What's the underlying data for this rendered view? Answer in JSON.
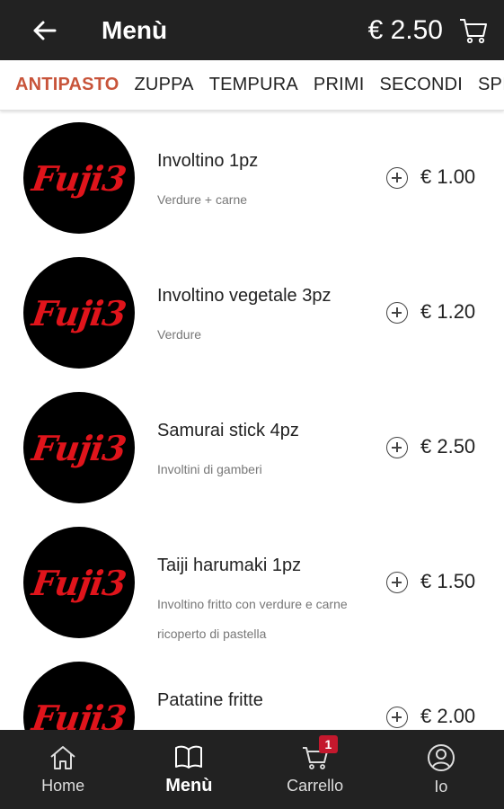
{
  "header": {
    "title": "Menù",
    "total": "€ 2.50",
    "back_icon": "arrow-left-icon",
    "cart_icon": "cart-icon"
  },
  "tabs": [
    {
      "label": "ANTIPASTO",
      "active": true
    },
    {
      "label": "ZUPPA"
    },
    {
      "label": "TEMPURA"
    },
    {
      "label": "PRIMI"
    },
    {
      "label": "SECONDI"
    },
    {
      "label": "SPI"
    }
  ],
  "items": [
    {
      "logo": "Fuji3",
      "name": "Involtino 1pz",
      "desc": "Verdure + carne",
      "price": "€ 1.00"
    },
    {
      "logo": "Fuji3",
      "name": "Involtino vegetale 3pz",
      "desc": "Verdure",
      "price": "€ 1.20"
    },
    {
      "logo": "Fuji3",
      "name": "Samurai stick 4pz",
      "desc": "Involtini di gamberi",
      "price": "€ 2.50"
    },
    {
      "logo": "Fuji3",
      "name": "Taiji harumaki 1pz",
      "desc": "Involtino fritto con verdure e carne ricoperto di pastella",
      "price": "€ 1.50"
    },
    {
      "logo": "Fuji3",
      "name": "Patatine fritte",
      "desc": "",
      "price": "€ 2.00"
    }
  ],
  "bottom_nav": [
    {
      "label": "Home",
      "icon": "home-icon"
    },
    {
      "label": "Menù",
      "icon": "book-icon",
      "active": true
    },
    {
      "label": "Carrello",
      "icon": "cart-icon",
      "badge": "1"
    },
    {
      "label": "Io",
      "icon": "user-icon"
    }
  ],
  "colors": {
    "bar_bg": "#222222",
    "accent": "#c8543a",
    "badge": "#c4182d",
    "logo_red": "#e0141b"
  }
}
